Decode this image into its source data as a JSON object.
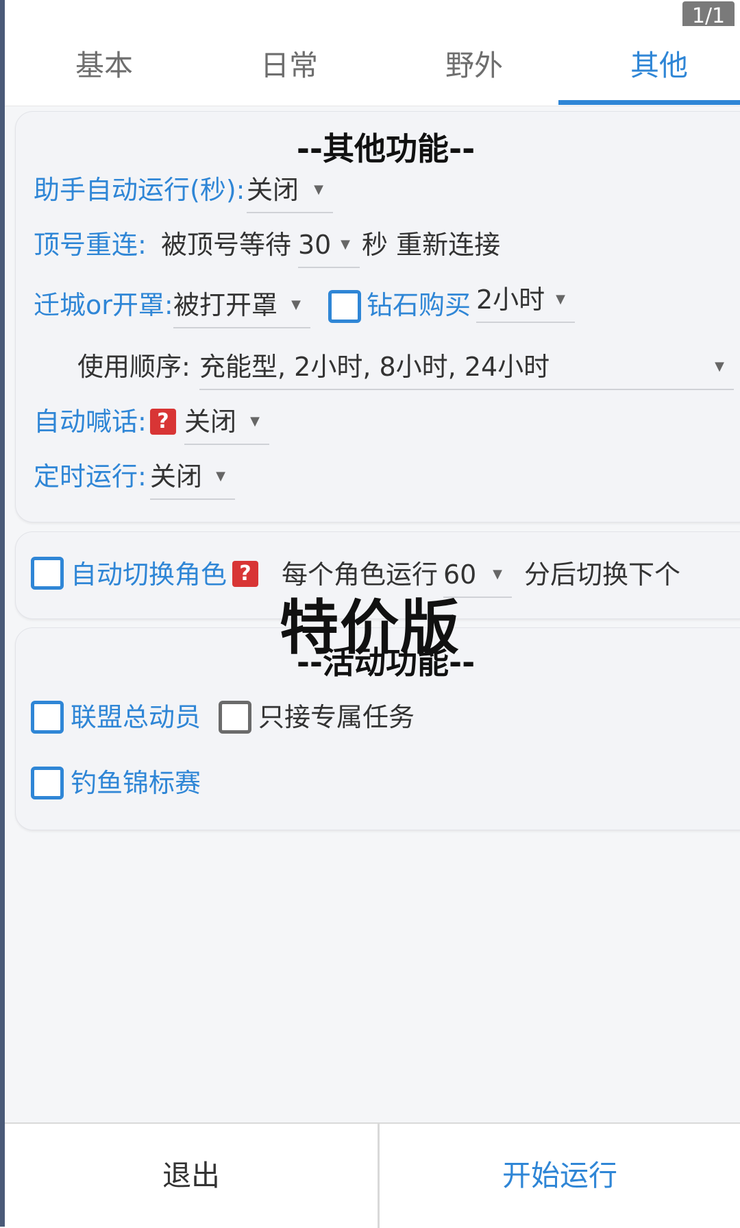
{
  "page_indicator": "1/1",
  "tabs": [
    {
      "label": "基本"
    },
    {
      "label": "日常"
    },
    {
      "label": "野外"
    },
    {
      "label": "其他",
      "active": true
    }
  ],
  "other_section": {
    "title": "--其他功能--",
    "auto_run": {
      "label": "助手自动运行(秒):",
      "value": "关闭"
    },
    "reconnect": {
      "label": "顶号重连:",
      "prefix": "被顶号等待",
      "value": "30",
      "suffix": "秒 重新连接"
    },
    "relocate": {
      "label": "迁城or开罩:",
      "value": "被打开罩",
      "diamond_label": "钻石购买",
      "diamond_value": "2小时"
    },
    "use_order": {
      "label": "使用顺序:",
      "value": "充能型, 2小时, 8小时, 24小时"
    },
    "auto_shout": {
      "label": "自动喊话:",
      "help": "?",
      "value": "关闭"
    },
    "timer_run": {
      "label": "定时运行:",
      "value": "关闭"
    }
  },
  "role_switch": {
    "label": "自动切换角色",
    "help": "?",
    "prefix": "每个角色运行",
    "value": "60",
    "suffix": "分后切换下个"
  },
  "watermark": "特价版",
  "activity_section": {
    "title": "--活动功能--",
    "alliance": {
      "label": "联盟总动员"
    },
    "exclusive": {
      "label": "只接专属任务"
    },
    "fishing": {
      "label": "钓鱼锦标赛"
    }
  },
  "buttons": {
    "exit": "退出",
    "start": "开始运行"
  },
  "colors": {
    "accent": "#2f86d6",
    "help_badge": "#d83535",
    "text": "#333333"
  }
}
